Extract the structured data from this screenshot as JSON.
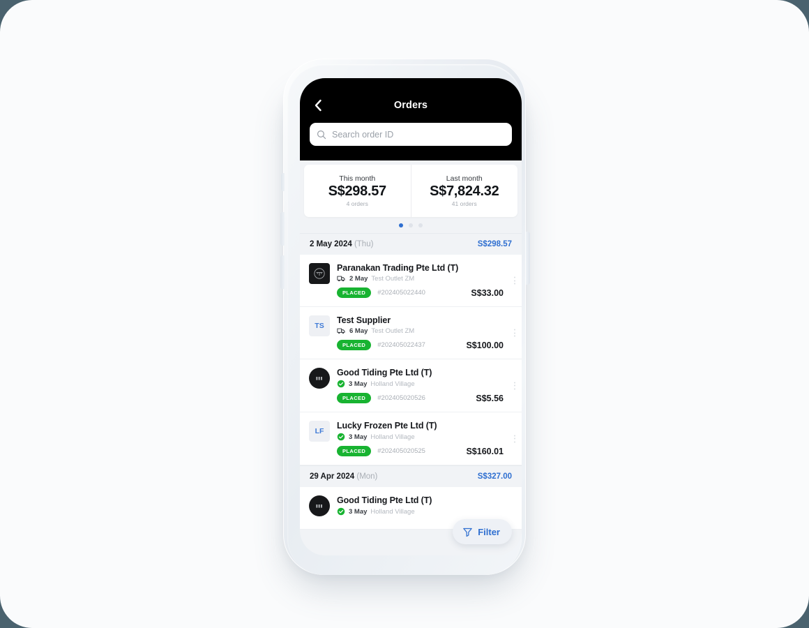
{
  "app": {
    "nav": {
      "back_icon": "chevron-left-icon",
      "title": "Orders"
    },
    "search": {
      "icon": "search-icon",
      "placeholder": "Search order ID",
      "value": ""
    },
    "summary": {
      "cards": [
        {
          "label": "This month",
          "value": "S$298.57",
          "sub": "4 orders"
        },
        {
          "label": "Last month",
          "value": "S$7,824.32",
          "sub": "41 orders"
        }
      ],
      "pagination": {
        "count": 3,
        "active_index": 0,
        "active_color": "#2f6fd0",
        "inactive_color": "#dfe3e9"
      }
    },
    "groups": [
      {
        "date": "2 May 2024",
        "day_of_week": "(Thu)",
        "total": "S$298.57",
        "orders": [
          {
            "avatar": {
              "type": "logo",
              "shape": "square",
              "style": "dark",
              "initials": "PT"
            },
            "supplier": "Paranakan Trading Pte Ltd (T)",
            "meta_icon": "delivery-truck-icon",
            "meta_date": "2 May",
            "outlet": "Test Outlet ZM",
            "status": "PLACED",
            "order_id": "#202405022440",
            "amount": "S$33.00"
          },
          {
            "avatar": {
              "type": "initials",
              "shape": "square",
              "style": "light",
              "initials": "TS"
            },
            "supplier": "Test Supplier",
            "meta_icon": "delivery-truck-icon",
            "meta_date": "6 May",
            "outlet": "Test Outlet ZM",
            "status": "PLACED",
            "order_id": "#202405022437",
            "amount": "S$100.00"
          },
          {
            "avatar": {
              "type": "logo",
              "shape": "circle",
              "style": "dark",
              "initials": "GT"
            },
            "supplier": "Good Tiding Pte Ltd (T)",
            "meta_icon": "check-circle-icon",
            "meta_date": "3 May",
            "outlet": "Holland Village",
            "status": "PLACED",
            "order_id": "#202405020526",
            "amount": "S$5.56"
          },
          {
            "avatar": {
              "type": "initials",
              "shape": "square",
              "style": "light",
              "initials": "LF"
            },
            "supplier": "Lucky Frozen Pte Ltd (T)",
            "meta_icon": "check-circle-icon",
            "meta_date": "3 May",
            "outlet": "Holland Village",
            "status": "PLACED",
            "order_id": "#202405020525",
            "amount": "S$160.01"
          }
        ]
      },
      {
        "date": "29 Apr 2024",
        "day_of_week": "(Mon)",
        "total": "S$327.00",
        "orders": [
          {
            "avatar": {
              "type": "logo",
              "shape": "circle",
              "style": "dark",
              "initials": "GT"
            },
            "supplier": "Good Tiding Pte Ltd (T)",
            "meta_icon": "check-circle-icon",
            "meta_date": "3 May",
            "outlet": "Holland Village",
            "status": "",
            "order_id": "",
            "amount": ""
          }
        ]
      }
    ],
    "filter_button": {
      "icon": "filter-funnel-icon",
      "label": "Filter"
    },
    "colors": {
      "accent_blue": "#2f6fd0",
      "status_green": "#18b331",
      "header_black": "#000000",
      "screen_bg": "#f1f3f6",
      "page_bg": "#4a626e"
    }
  }
}
